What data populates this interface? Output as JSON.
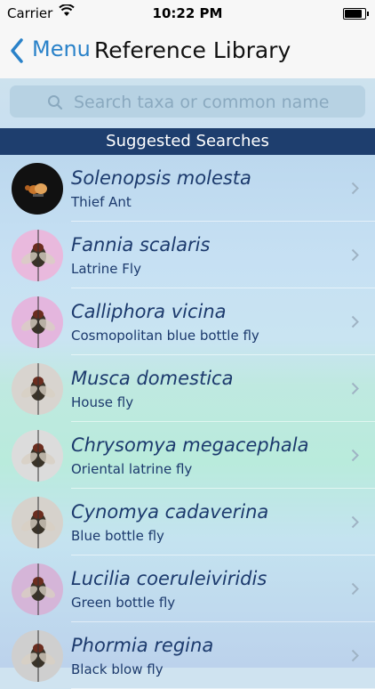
{
  "status_bar": {
    "carrier": "Carrier",
    "time": "10:22 PM",
    "battery_level": 0.95
  },
  "nav": {
    "back_label": "Menu",
    "title": "Reference Library"
  },
  "search": {
    "placeholder": "Search taxa or common name",
    "value": ""
  },
  "section": {
    "header": "Suggested Searches"
  },
  "items": [
    {
      "scientific": "Solenopsis molesta",
      "common": "Thief Ant",
      "thumb_bg": "#111111",
      "icon": "ant-thumbnail"
    },
    {
      "scientific": "Fannia scalaris",
      "common": "Latrine Fly",
      "thumb_bg": "#e9b9dd",
      "icon": "fly-thumbnail"
    },
    {
      "scientific": "Calliphora vicina",
      "common": "Cosmopolitan blue bottle fly",
      "thumb_bg": "#e4b6de",
      "icon": "fly-thumbnail"
    },
    {
      "scientific": "Musca domestica",
      "common": "House fly",
      "thumb_bg": "#d8d4cf",
      "icon": "fly-thumbnail"
    },
    {
      "scientific": "Chrysomya megacephala",
      "common": "Oriental latrine fly",
      "thumb_bg": "#dcdcdc",
      "icon": "fly-thumbnail"
    },
    {
      "scientific": "Cynomya cadaverina",
      "common": "Blue bottle fly",
      "thumb_bg": "#d6d2cc",
      "icon": "fly-thumbnail"
    },
    {
      "scientific": "Lucilia coeruleiviridis",
      "common": "Green bottle fly",
      "thumb_bg": "#d5b5d8",
      "icon": "fly-thumbnail"
    },
    {
      "scientific": "Phormia regina",
      "common": "Black blow fly",
      "thumb_bg": "#cfcfcf",
      "icon": "fly-thumbnail"
    }
  ]
}
